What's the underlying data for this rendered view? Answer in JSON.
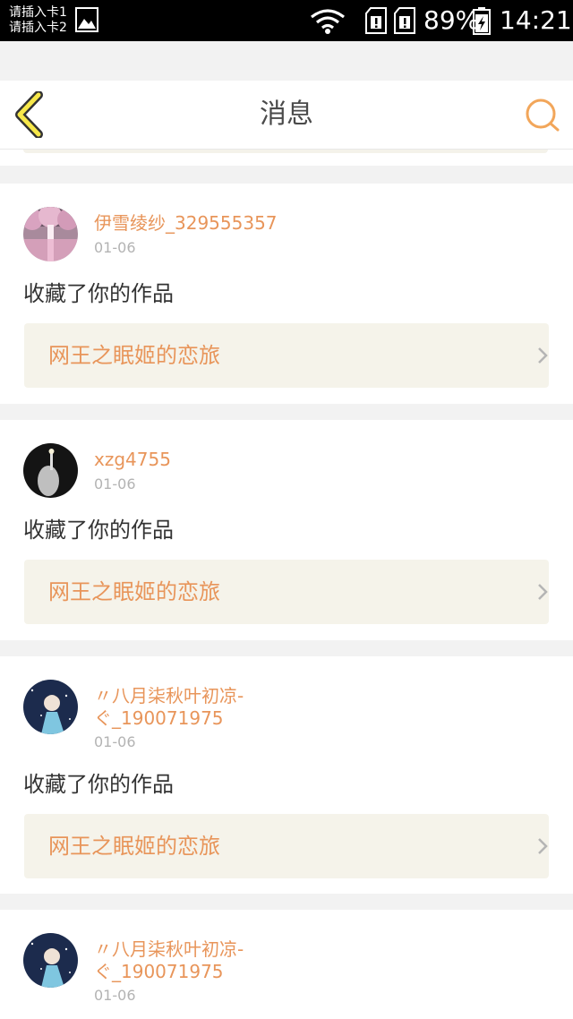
{
  "status_bar": {
    "sim_labels": [
      "请插入卡1",
      "请插入卡2"
    ],
    "battery": "89%",
    "time": "14:21",
    "icons": [
      "gallery-icon",
      "wifi-icon",
      "sim-icon",
      "sim-icon",
      "battery-charging-icon"
    ]
  },
  "header": {
    "title": "消息",
    "back_icon": "chevron-left-icon",
    "search_icon": "search-icon",
    "accent_color": "#f2a65a"
  },
  "messages": [
    {
      "username": "伊雪绫纱_329555357",
      "date": "01-06",
      "action": "收藏了你的作品",
      "work_title": "网王之眠姬的恋旅",
      "avatar": "pink-trees-avatar"
    },
    {
      "username": "xzg4755",
      "date": "01-06",
      "action": "收藏了你的作品",
      "work_title": "网王之眠姬的恋旅",
      "avatar": "dark-hand-avatar"
    },
    {
      "username_line1": "〃八月柒秋叶初凉-",
      "username_line2": "ぐ_190071975",
      "date": "01-06",
      "action": "收藏了你的作品",
      "work_title": "网王之眠姬的恋旅",
      "avatar": "anime-night-avatar"
    },
    {
      "username_line1": "〃八月柒秋叶初凉-",
      "username_line2": "ぐ_190071975",
      "date": "01-06",
      "avatar": "anime-night-avatar"
    }
  ],
  "colors": {
    "name": "#e8955a",
    "link_bg": "#f5f3ea",
    "date": "#b3b3b3"
  }
}
